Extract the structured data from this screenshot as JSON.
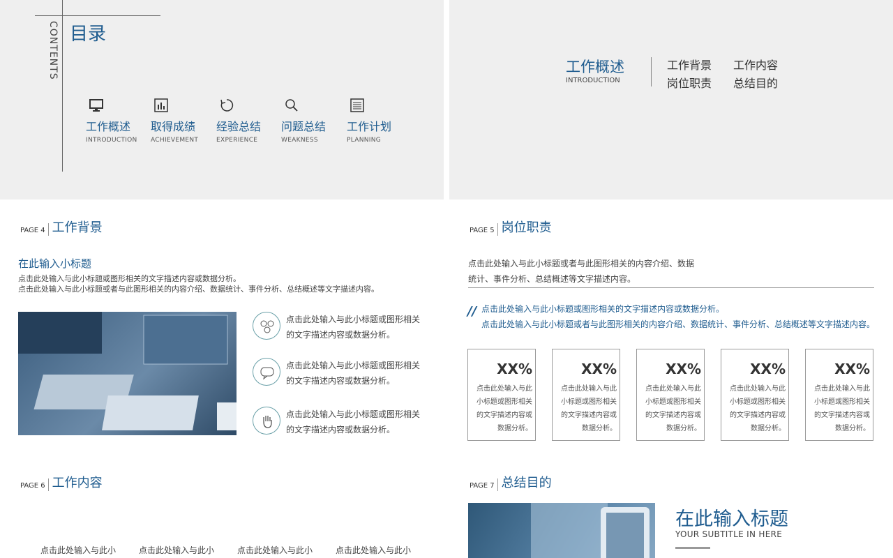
{
  "contents": {
    "vertical_label": "CONTENTS",
    "title": "目录",
    "items": [
      {
        "icon": "monitor-icon",
        "zh": "工作概述",
        "en": "INTRODUCTION"
      },
      {
        "icon": "bar-chart-icon",
        "zh": "取得成绩",
        "en": "ACHIEVEMENT"
      },
      {
        "icon": "refresh-icon",
        "zh": "经验总结",
        "en": "EXPERIENCE"
      },
      {
        "icon": "search-icon",
        "zh": "问题总结",
        "en": "WEAKNESS"
      },
      {
        "icon": "list-icon",
        "zh": "工作计划",
        "en": "PLANNING"
      }
    ]
  },
  "intro": {
    "title_zh": "工作概述",
    "title_en": "INTRODUCTION",
    "subs": [
      "工作背景",
      "工作内容",
      "岗位职责",
      "总结目的"
    ]
  },
  "page4": {
    "page": "PAGE 4",
    "title": "工作背景",
    "subtitle": "在此输入小标题",
    "desc1": "点击此处输入与此小标题或图形相关的文字描述内容或数据分析。",
    "desc2": "点击此处输入与此小标题或者与此图形相关的内容介绍、数据统计、事件分析、总结概述等文字描述内容。",
    "features": [
      {
        "icon": "network-icon",
        "line1": "点击此处输入与此小标题或图形相关",
        "line2": "的文字描述内容或数据分析。"
      },
      {
        "icon": "chat-bubble-icon",
        "line1": "点击此处输入与此小标题或图形相关",
        "line2": "的文字描述内容或数据分析。"
      },
      {
        "icon": "hand-icon",
        "line1": "点击此处输入与此小标题或图形相关",
        "line2": "的文字描述内容或数据分析。"
      }
    ]
  },
  "page5": {
    "page": "PAGE 5",
    "title": "岗位职责",
    "intro1": "点击此处输入与此小标题或者与此图形相关的内容介绍、数据",
    "intro2": "统计、事件分析、总结概述等文字描述内容。",
    "quote_mark": "//",
    "quote1": "点击此处输入与此小标题或图形相关的文字描述内容或数据分析。",
    "quote2": "点击此处输入与此小标题或者与此图形相关的内容介绍、数据统计、事件分析、总结概述等文字描述内容。",
    "cards": [
      {
        "pct": "XX%",
        "l1": "点击此处输入与此",
        "l2": "小标题或图形相关",
        "l3": "的文字描述内容或",
        "l4": "数据分析。"
      },
      {
        "pct": "XX%",
        "l1": "点击此处输入与此",
        "l2": "小标题或图形相关",
        "l3": "的文字描述内容或",
        "l4": "数据分析。"
      },
      {
        "pct": "XX%",
        "l1": "点击此处输入与此",
        "l2": "小标题或图形相关",
        "l3": "的文字描述内容或",
        "l4": "数据分析。"
      },
      {
        "pct": "XX%",
        "l1": "点击此处输入与此",
        "l2": "小标题或图形相关",
        "l3": "的文字描述内容或",
        "l4": "数据分析。"
      },
      {
        "pct": "XX%",
        "l1": "点击此处输入与此",
        "l2": "小标题或图形相关",
        "l3": "的文字描述内容或",
        "l4": "数据分析。"
      }
    ]
  },
  "page6": {
    "page": "PAGE 6",
    "title": "工作内容",
    "cols": [
      "点击此处输入与此小",
      "点击此处输入与此小",
      "点击此处输入与此小",
      "点击此处输入与此小"
    ]
  },
  "page7": {
    "page": "PAGE 7",
    "title": "总结目的",
    "heading": "在此输入标题",
    "subtitle": "YOUR SUBTITLE IN HERE"
  }
}
